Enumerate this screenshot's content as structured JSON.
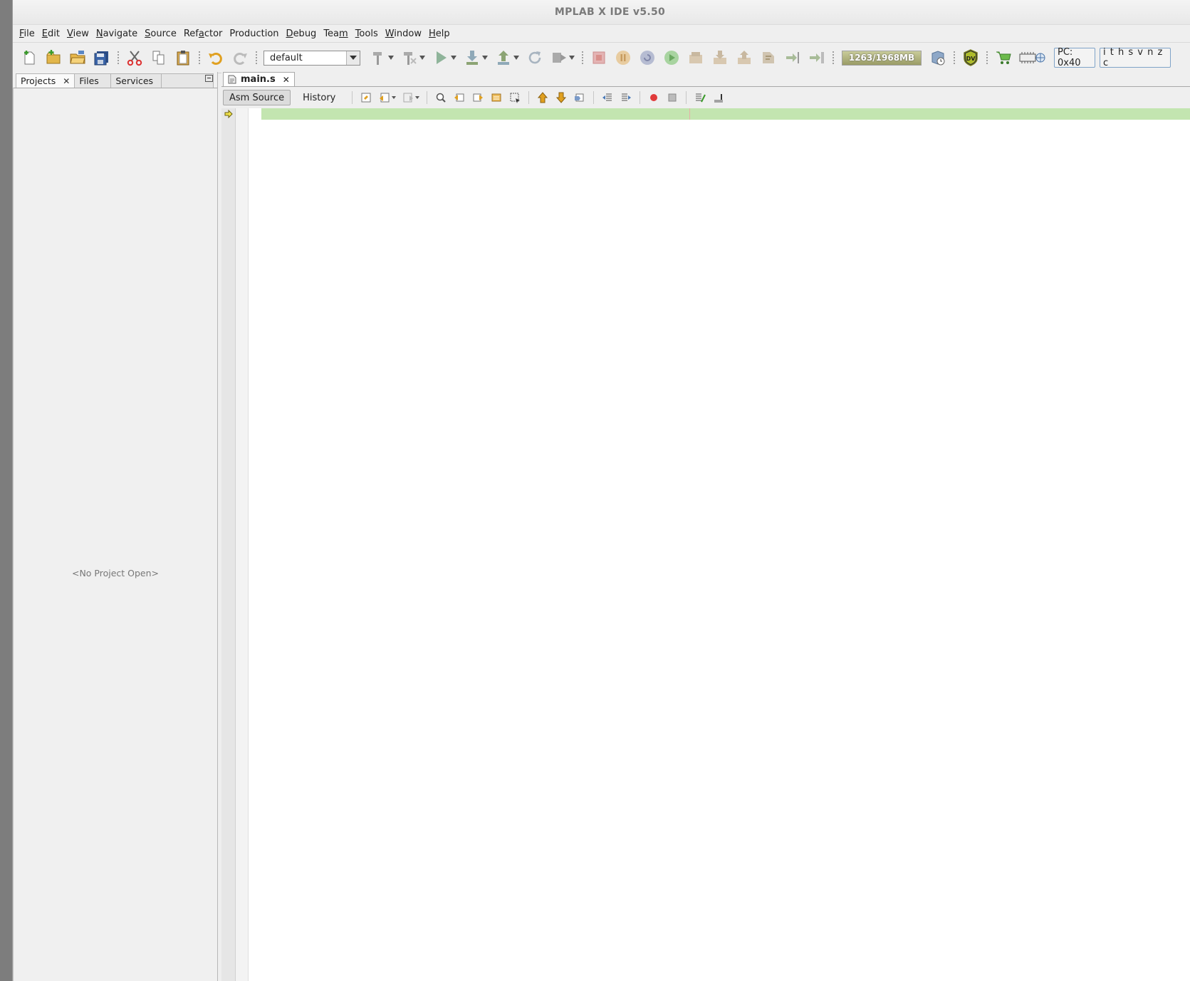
{
  "window": {
    "title": "MPLAB X IDE v5.50"
  },
  "menubar": {
    "items": [
      {
        "label": "File",
        "u": "F",
        "rest": "ile"
      },
      {
        "label": "Edit",
        "u": "E",
        "rest": "dit"
      },
      {
        "label": "View",
        "u": "V",
        "rest": "iew"
      },
      {
        "label": "Navigate",
        "u": "N",
        "rest": "avigate"
      },
      {
        "label": "Source",
        "u": "S",
        "rest": "ource"
      },
      {
        "label": "Refactor",
        "pre": "Ref",
        "u": "a",
        "rest": "ctor"
      },
      {
        "label": "Production",
        "u": "",
        "rest": "Production"
      },
      {
        "label": "Debug",
        "u": "D",
        "rest": "ebug"
      },
      {
        "label": "Team",
        "pre": "Tea",
        "u": "m",
        "rest": ""
      },
      {
        "label": "Tools",
        "u": "T",
        "rest": "ools"
      },
      {
        "label": "Window",
        "u": "W",
        "rest": "indow"
      },
      {
        "label": "Help",
        "u": "H",
        "rest": "elp"
      }
    ]
  },
  "toolbar": {
    "configuration": "default",
    "memory": "1263/1968MB",
    "pc": "PC: 0x40",
    "status_flags": "i t h s v n z c"
  },
  "left_panel": {
    "tabs": [
      {
        "label": "Projects",
        "closable": true,
        "active": true
      },
      {
        "label": "Files"
      },
      {
        "label": "Services"
      }
    ],
    "empty_message": "<No Project Open>"
  },
  "editor": {
    "tab": {
      "label": "main.s"
    },
    "views": {
      "source": "Asm Source",
      "history": "History"
    }
  },
  "colors": {
    "current_line": "#c3e5b0",
    "memory_bar": "#9a9c66",
    "pc_box_border": "#7fa3c8"
  }
}
